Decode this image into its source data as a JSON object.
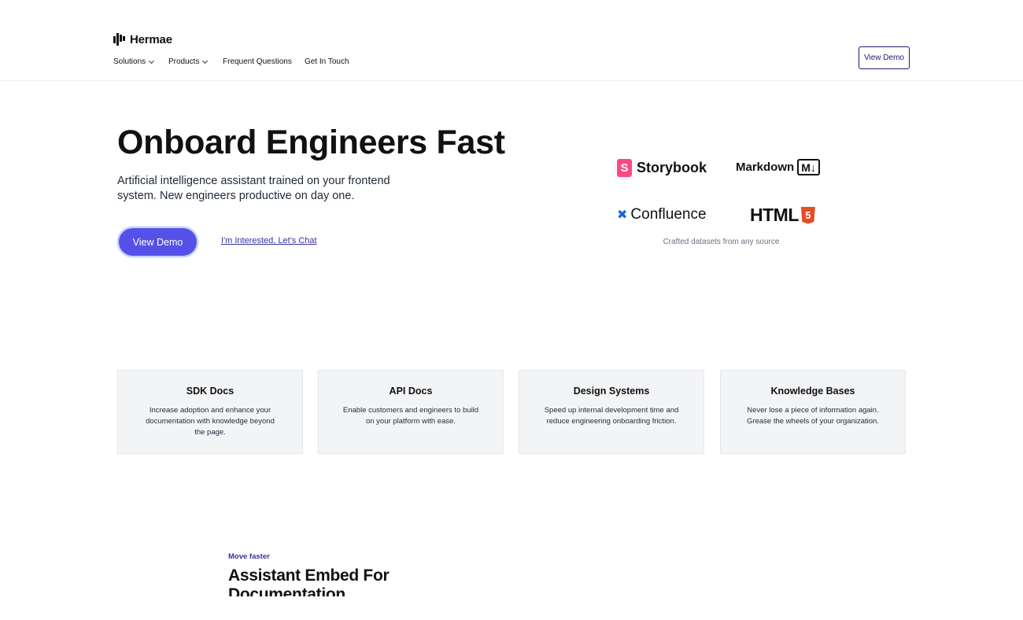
{
  "brand": {
    "name": "Hermae"
  },
  "nav": {
    "items": [
      {
        "label": "Solutions",
        "dropdown": true
      },
      {
        "label": "Products",
        "dropdown": true
      },
      {
        "label": "Frequent Questions",
        "dropdown": false
      },
      {
        "label": "Get In Touch",
        "dropdown": false
      }
    ],
    "cta_label": "View Demo"
  },
  "hero": {
    "title": "Onboard Engineers Fast",
    "subtitle": "Artificial intelligence assistant trained on your frontend system. New engineers productive on day one.",
    "primary_cta": "View Demo",
    "secondary_cta": "I'm Interested, Let's Chat"
  },
  "sources": {
    "storybook": {
      "icon_letter": "S",
      "label": "Storybook",
      "color": "#ff4785"
    },
    "markdown": {
      "label": "Markdown",
      "badge": "M↓"
    },
    "confluence": {
      "icon": "✖",
      "label": "Confluence",
      "color": "#1868db"
    },
    "html": {
      "label": "HTML",
      "badge": "5",
      "color": "#e44d26"
    },
    "caption": "Crafted datasets from any source"
  },
  "cards": [
    {
      "title": "SDK Docs",
      "desc": "Increase adoption and enhance your documentation with knowledge beyond the page."
    },
    {
      "title": "API Docs",
      "desc": "Enable customers and engineers to build on your platform with ease."
    },
    {
      "title": "Design Systems",
      "desc": "Speed up internal development time and reduce engineering onboarding friction."
    },
    {
      "title": "Knowledge Bases",
      "desc": "Never lose a piece of information again. Grease the wheels of your organization."
    }
  ],
  "section": {
    "eyebrow": "Move faster",
    "title": "Assistant Embed For Documentation"
  },
  "colors": {
    "accent": "#5551e8",
    "link": "#3730a3",
    "card_bg": "#f3f4f6"
  }
}
